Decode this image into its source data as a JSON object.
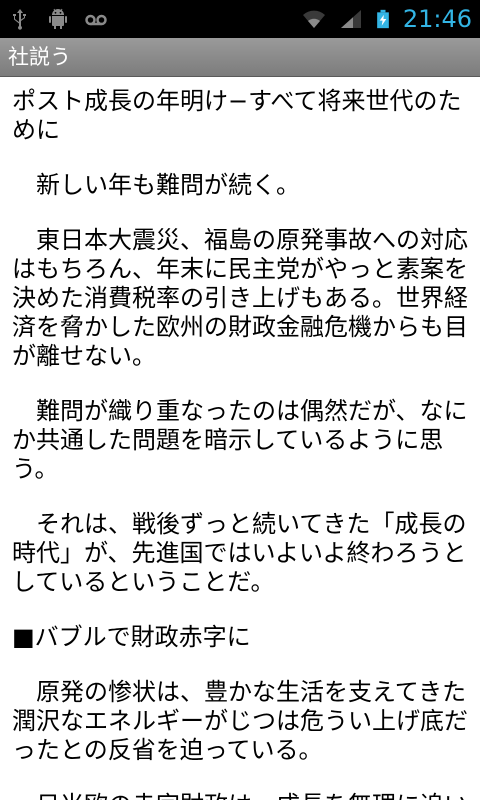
{
  "status_bar": {
    "time": "21:46",
    "icons": [
      "usb-icon",
      "android-debug-icon",
      "voicemail-icon",
      "wifi-icon",
      "signal-icon",
      "battery-charging-icon"
    ],
    "accent_color": "#33b5e5"
  },
  "title_bar": {
    "title": "社説う"
  },
  "article": {
    "headline": "ポスト成長の年明け−すべて将来世代のために",
    "paragraphs": [
      "　新しい年も難問が続く。",
      "　東日本大震災、福島の原発事故への対応はもちろん、年末に民主党がやっと素案を決めた消費税率の引き上げもある。世界経済を脅かした欧州の財政金融危機からも目が離せない。",
      "　難問が織り重なったのは偶然だが、なにか共通した問題を暗示しているように思う。",
      "　それは、戦後ずっと続いてきた「成長の時代」が、先進国ではいよいよ終わろうとしているということだ。"
    ],
    "section_heading": "■バブルで財政赤字に",
    "section_paragraphs": [
      "　原発の惨状は、豊かな生活を支えてきた潤沢なエネルギーがじつは危うい上げ底だったとの反省を迫っている。",
      "　日米欧の赤字財政は、成長を無理に追い"
    ]
  }
}
